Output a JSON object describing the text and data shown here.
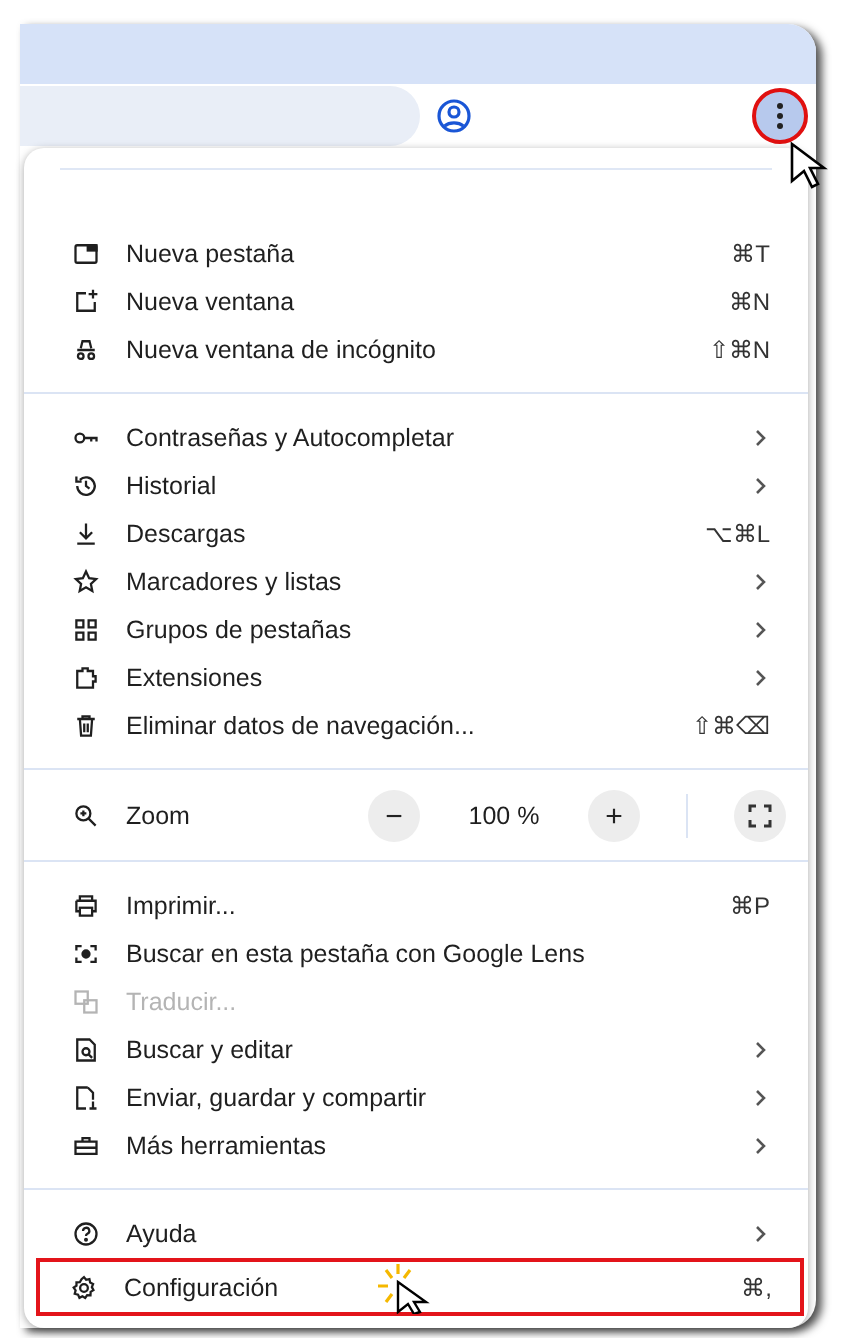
{
  "toolbar": {
    "menu_button": {
      "highlighted": true
    }
  },
  "menu": {
    "sections": [
      {
        "kind": "items",
        "items": [
          {
            "label": "Nueva pestaña",
            "shortcut": "⌘T",
            "submenu": false,
            "disabled": false,
            "highlighted": false
          },
          {
            "label": "Nueva ventana",
            "shortcut": "⌘N",
            "submenu": false,
            "disabled": false,
            "highlighted": false
          },
          {
            "label": "Nueva ventana de incógnito",
            "shortcut": "⇧⌘N",
            "submenu": false,
            "disabled": false,
            "highlighted": false
          }
        ]
      },
      {
        "kind": "items",
        "items": [
          {
            "label": "Contraseñas y Autocompletar",
            "submenu": true,
            "disabled": false,
            "highlighted": false
          },
          {
            "label": "Historial",
            "submenu": true,
            "disabled": false,
            "highlighted": false
          },
          {
            "label": "Descargas",
            "shortcut": "⌥⌘L",
            "submenu": false,
            "disabled": false,
            "highlighted": false
          },
          {
            "label": "Marcadores y listas",
            "submenu": true,
            "disabled": false,
            "highlighted": false
          },
          {
            "label": "Grupos de pestañas",
            "submenu": true,
            "disabled": false,
            "highlighted": false
          },
          {
            "label": "Extensiones",
            "submenu": true,
            "disabled": false,
            "highlighted": false
          },
          {
            "label": "Eliminar datos de navegación...",
            "shortcut": "⇧⌘⌫",
            "submenu": false,
            "disabled": false,
            "highlighted": false
          }
        ]
      },
      {
        "kind": "zoom",
        "label": "Zoom",
        "value": "100 %",
        "minus": "−",
        "plus": "+"
      },
      {
        "kind": "items",
        "items": [
          {
            "label": "Imprimir...",
            "shortcut": "⌘P",
            "submenu": false,
            "disabled": false,
            "highlighted": false
          },
          {
            "label": "Buscar en esta pestaña con Google Lens",
            "submenu": false,
            "disabled": false,
            "highlighted": false
          },
          {
            "label": "Traducir...",
            "submenu": false,
            "disabled": true,
            "highlighted": false
          },
          {
            "label": "Buscar y editar",
            "submenu": true,
            "disabled": false,
            "highlighted": false
          },
          {
            "label": "Enviar, guardar y compartir",
            "submenu": true,
            "disabled": false,
            "highlighted": false
          },
          {
            "label": "Más herramientas",
            "submenu": true,
            "disabled": false,
            "highlighted": false
          }
        ]
      },
      {
        "kind": "items",
        "items": [
          {
            "label": "Ayuda",
            "submenu": true,
            "disabled": false,
            "highlighted": false
          },
          {
            "label": "Configuración",
            "shortcut": "⌘,",
            "submenu": false,
            "disabled": false,
            "highlighted": true
          }
        ]
      }
    ]
  }
}
